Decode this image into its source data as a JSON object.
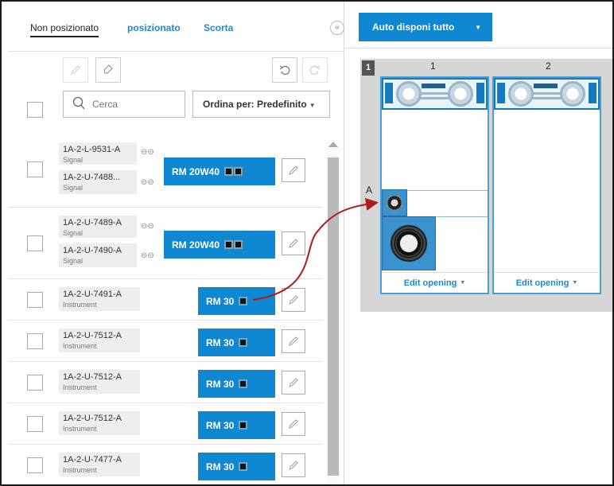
{
  "tabs": [
    {
      "label": "Non posizionato"
    },
    {
      "label": "posizionato"
    },
    {
      "label": "Scorta"
    }
  ],
  "collapse_label": "«",
  "search": {
    "placeholder": "Cerca"
  },
  "sort": {
    "label": "Ordina per: Predefinito"
  },
  "items": [
    {
      "tags": [
        {
          "name": "1A-2-L-9531-A",
          "type": "Signal"
        },
        {
          "name": "1A-2-U-7488...",
          "type": "Signal"
        }
      ],
      "rm": "RM 20W40",
      "cables": 2
    },
    {
      "tags": [
        {
          "name": "1A-2-U-7489-A",
          "type": "Signal"
        },
        {
          "name": "1A-2-U-7490-A",
          "type": "Signal"
        }
      ],
      "rm": "RM 20W40",
      "cables": 2
    },
    {
      "tags": [
        {
          "name": "1A-2-U-7491-A",
          "type": "Instrument"
        }
      ],
      "rm": "RM 30",
      "cables": 1
    },
    {
      "tags": [
        {
          "name": "1A-2-U-7512-A",
          "type": "Instrument"
        }
      ],
      "rm": "RM 30",
      "cables": 1
    },
    {
      "tags": [
        {
          "name": "1A-2-U-7512-A",
          "type": "Instrument"
        }
      ],
      "rm": "RM 30",
      "cables": 1
    },
    {
      "tags": [
        {
          "name": "1A-2-U-7512-A",
          "type": "Instrument"
        }
      ],
      "rm": "RM 30",
      "cables": 1
    },
    {
      "tags": [
        {
          "name": "1A-2-U-7477-A",
          "type": "Instrument"
        }
      ],
      "rm": "RM 30",
      "cables": 1
    }
  ],
  "toolbar": {
    "auto_label": "Auto disponi tutto"
  },
  "grid": {
    "row_number": "1",
    "row_label": "A",
    "columns": [
      {
        "label": "1",
        "edit_label": "Edit opening"
      },
      {
        "label": "2",
        "edit_label": "Edit opening"
      }
    ]
  },
  "colors": {
    "accent": "#0f88d1",
    "link": "#1a8ad0",
    "arrow": "#b0191e"
  }
}
